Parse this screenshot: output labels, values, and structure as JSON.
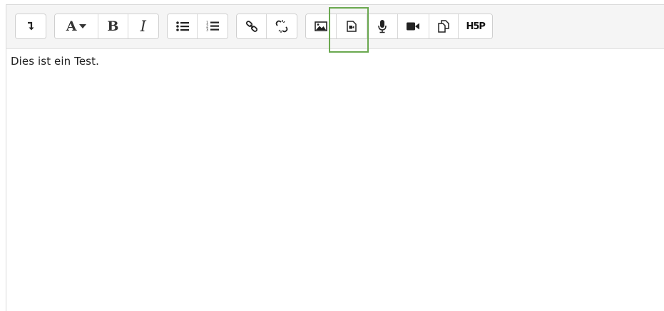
{
  "toolbar": {
    "groups": [
      {
        "name": "show-more",
        "buttons": [
          {
            "name": "show-more-button",
            "icon": "toggle-arrow-icon"
          }
        ]
      },
      {
        "name": "formatting",
        "buttons": [
          {
            "name": "paragraph-style-button",
            "icon": "font-dropdown-icon",
            "label": "A"
          },
          {
            "name": "bold-button",
            "icon": "bold-icon",
            "label": "B"
          },
          {
            "name": "italic-button",
            "icon": "italic-icon",
            "label": "I"
          }
        ]
      },
      {
        "name": "lists",
        "buttons": [
          {
            "name": "unordered-list-button",
            "icon": "bullet-list-icon"
          },
          {
            "name": "ordered-list-button",
            "icon": "numbered-list-icon"
          }
        ]
      },
      {
        "name": "links",
        "buttons": [
          {
            "name": "link-button",
            "icon": "link-icon"
          },
          {
            "name": "unlink-button",
            "icon": "unlink-icon"
          }
        ]
      },
      {
        "name": "media",
        "buttons": [
          {
            "name": "insert-image-button",
            "icon": "image-icon"
          },
          {
            "name": "insert-media-button",
            "icon": "media-file-icon"
          },
          {
            "name": "record-audio-button",
            "icon": "microphone-icon"
          },
          {
            "name": "record-video-button",
            "icon": "video-camera-icon"
          },
          {
            "name": "manage-files-button",
            "icon": "files-icon"
          },
          {
            "name": "insert-h5p-button",
            "icon": "h5p-icon",
            "label": "H5P"
          }
        ]
      }
    ],
    "h5p_label": "H5P",
    "font_label": "A",
    "bold_label": "B",
    "italic_label": "I"
  },
  "content": {
    "text": "Dies ist ein Test."
  },
  "colors": {
    "highlight": "#6aa84f",
    "toolbar_bg": "#f5f5f5"
  }
}
